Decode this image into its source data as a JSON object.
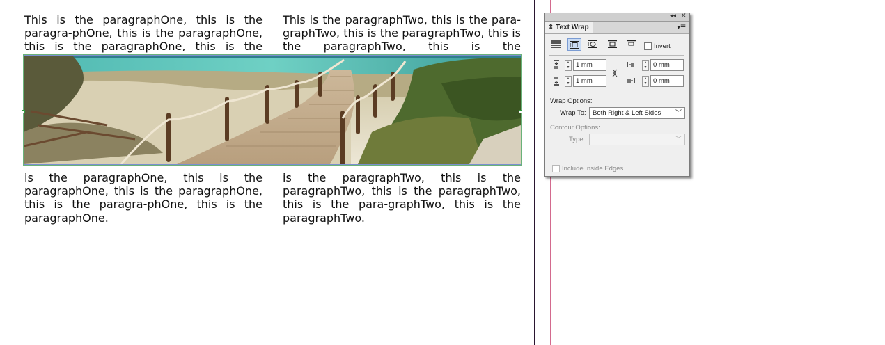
{
  "document": {
    "paragraphs": [
      {
        "id": "p1-top",
        "text": "This is the paragraphOne, this is the paragra-phOne, this is the paragraphOne, this is the paragraphOne, this is the paragraphOne, this"
      },
      {
        "id": "p2-top",
        "text": "This is the paragraphTwo, this is the para-graphTwo, this is the paragraphTwo, this is the paragraphTwo, this is the paragraphTwo, this"
      },
      {
        "id": "p1-bottom",
        "text": "is the paragraphOne, this is the paragraphOne, this is the paragraphOne, this is the paragra-phOne, this is the paragraphOne."
      },
      {
        "id": "p2-bottom",
        "text": "is the paragraphTwo, this is the paragraphTwo, this is the paragraphTwo, this is the para-graphTwo, this is the paragraphTwo."
      }
    ],
    "image_subject": "beach-boardwalk-image"
  },
  "panel": {
    "title": "Text Wrap",
    "collapse_glyph": "◂◂",
    "close_glyph": "✕",
    "menu_glyph": "▾☰",
    "wrap_modes": [
      "no-text-wrap",
      "wrap-around-bounding-box",
      "wrap-around-object-shape",
      "jump-object",
      "jump-to-next-column"
    ],
    "selected_wrap_mode": "wrap-around-bounding-box",
    "invert_label": "Invert",
    "offsets": {
      "top": "1 mm",
      "bottom": "1 mm",
      "left": "0 mm",
      "right": "0 mm"
    },
    "wrap_options_label": "Wrap Options:",
    "wrap_to_label": "Wrap To:",
    "wrap_to_value": "Both Right & Left Sides",
    "contour_options_label": "Contour Options:",
    "type_label": "Type:",
    "type_value": "",
    "include_inside_edges_label": "Include Inside Edges"
  },
  "colors": {
    "margin_guide": "#c46aa8",
    "page_edge": "#222222",
    "wrap_boundary": "#6ab27a",
    "selected_button": "#c9dbf4"
  }
}
